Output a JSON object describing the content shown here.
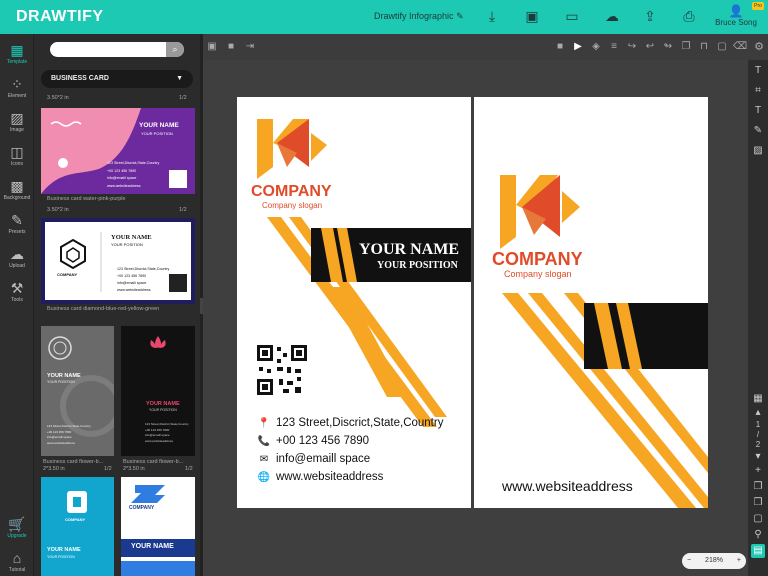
{
  "app": {
    "logo": "DRAWTIFY",
    "doc_title": "Drawtify Infographic",
    "pro_badge": "Pro",
    "user_name": "Bruce Song"
  },
  "topbar_icons": [
    "edit-icon",
    "download-icon",
    "save-icon",
    "present-icon",
    "cloud-icon",
    "share-icon",
    "print-icon"
  ],
  "leftnav": [
    {
      "label": "Template",
      "icon": "template-icon"
    },
    {
      "label": "Element",
      "icon": "element-icon"
    },
    {
      "label": "Image",
      "icon": "image-icon"
    },
    {
      "label": "Icons",
      "icon": "icons-icon"
    },
    {
      "label": "Background",
      "icon": "background-icon"
    },
    {
      "label": "Presets",
      "icon": "presets-icon"
    },
    {
      "label": "Upload",
      "icon": "upload-icon"
    },
    {
      "label": "Tools",
      "icon": "tools-icon"
    },
    {
      "label": "Upgrade",
      "icon": "cart-icon"
    },
    {
      "label": "Tutorial",
      "icon": "tutorial-icon"
    }
  ],
  "panel": {
    "search_placeholder": "",
    "category": "BUSINESS CARD",
    "templates": [
      {
        "size": "3.50*2 in",
        "count": "1/2",
        "caption": "Business card water-pink-purple"
      },
      {
        "size": "3.50*2 in",
        "count": "1/2",
        "caption": "Business card diamond-blue-red-yellow-green"
      },
      {
        "size": "2*3.50 in",
        "count": "1/2",
        "caption": "Business card flower-b..."
      },
      {
        "size": "2*3.50 in",
        "count": "1/2",
        "caption": "Business card flower-b..."
      }
    ],
    "thumb_text": {
      "your_name": "YOUR NAME",
      "your_position": "YOUR POSITION",
      "company": "COMPANY",
      "company_upper_small": "COMPANY",
      "t1_lines": [
        "123 Street,Discrict,State,Country",
        "+00 123 456 7890",
        "info@emaill space",
        "www.websiteaddress"
      ],
      "your_name_title": "YOUR NAME"
    }
  },
  "card_front": {
    "company": "COMPANY",
    "slogan": "Company  slogan",
    "name": "YOUR NAME",
    "position": "YOUR POSITION",
    "address": "123 Street,Discrict,State,Country",
    "phone": "+00 123 456 7890",
    "email": "info@emaill space",
    "website": "www.websiteaddress"
  },
  "card_back": {
    "company": "COMPANY",
    "slogan": "Company  slogan",
    "website": "www.websiteaddress"
  },
  "colors": {
    "accent": "#1ec9b4",
    "brand_orange": "#f6a623",
    "brand_red": "#e04b2a",
    "black": "#111111"
  },
  "page_nav": {
    "current": "1",
    "total": "2"
  },
  "zoom": {
    "value": "218%",
    "minus": "−",
    "plus": "+"
  }
}
